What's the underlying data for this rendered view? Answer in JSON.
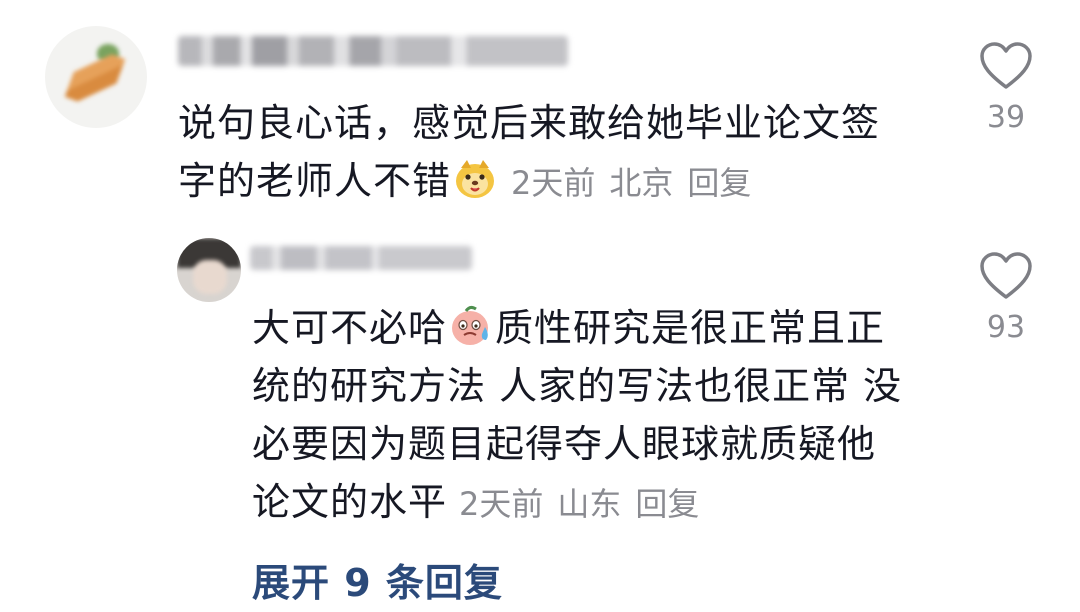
{
  "comments": [
    {
      "text": "说句良心话，感觉后来敢给她毕业论文签字的老师人不错",
      "time": "2天前",
      "location": "北京",
      "reply_label": "回复",
      "likes": "39",
      "emoji": "puppy-emoji"
    },
    {
      "text_before_emoji": "大可不必哈",
      "text_after_emoji": "质性研究是很正常且正统的研究方法 人家的写法也很正常 没必要因为题目起得夺人眼球就质疑他论文的水平",
      "time": "2天前",
      "location": "山东",
      "reply_label": "回复",
      "likes": "93",
      "emoji": "sweat-face-emoji"
    }
  ],
  "expand_replies": "展开 9 条回复",
  "colors": {
    "text": "#161823",
    "meta": "#8a8b91",
    "link": "#2b4a7a"
  }
}
